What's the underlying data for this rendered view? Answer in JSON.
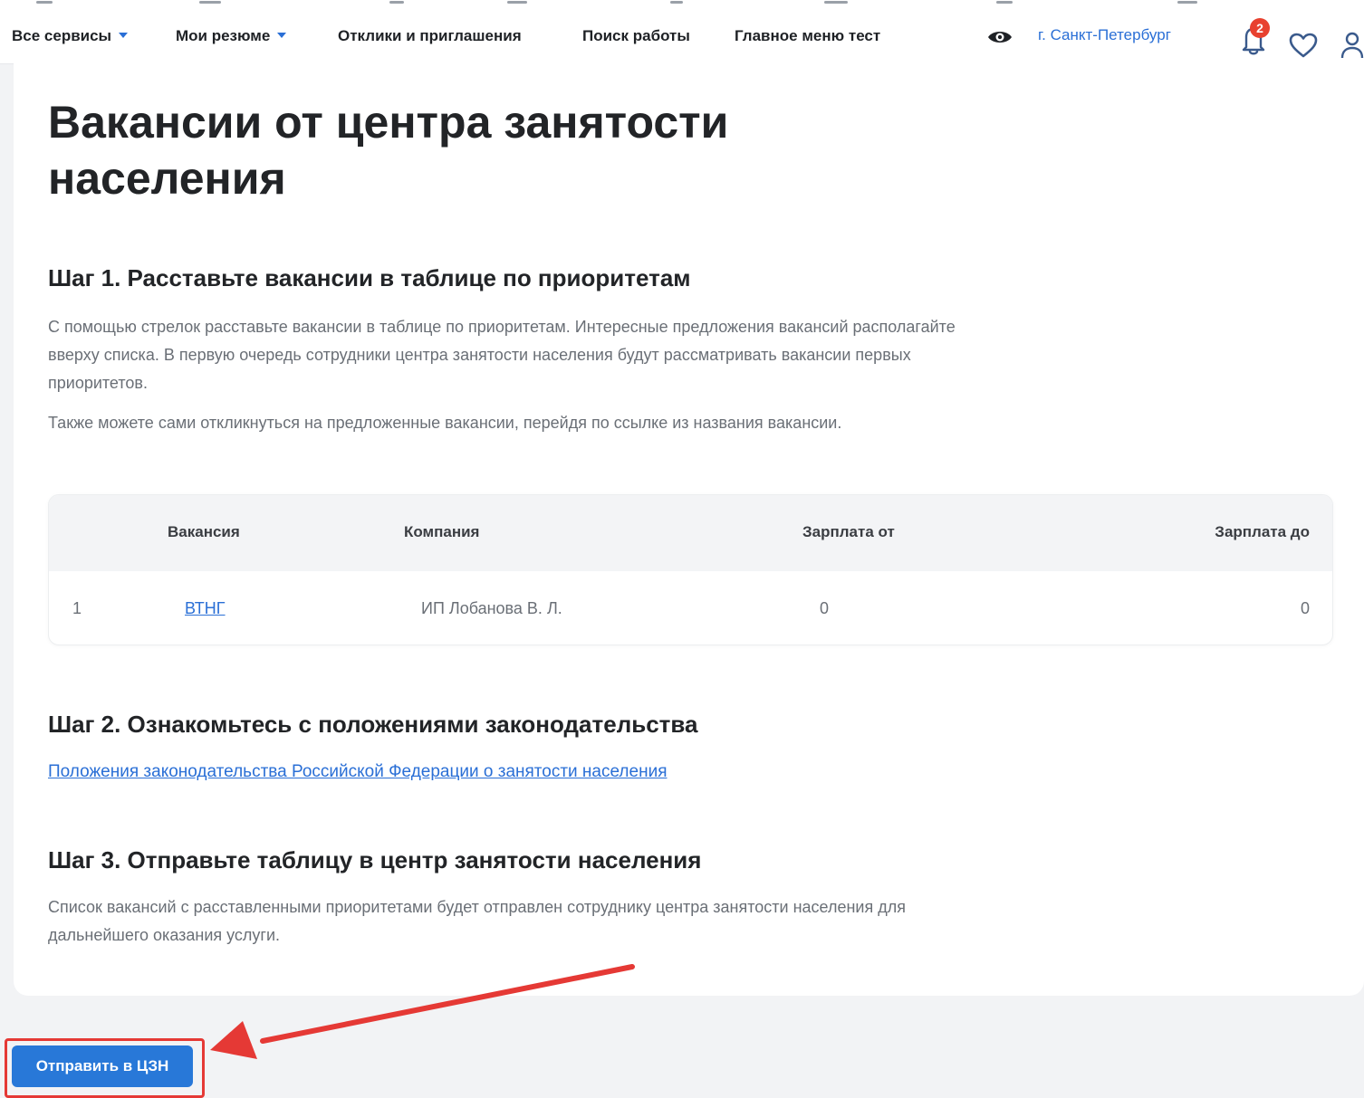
{
  "header": {
    "nav": [
      {
        "label": "Все сервисы",
        "dropdown": true
      },
      {
        "label": "Мои резюме",
        "dropdown": true
      },
      {
        "label": "Отклики и приглашения",
        "dropdown": false
      },
      {
        "label": "Поиск работы",
        "dropdown": false
      },
      {
        "label": "Главное меню тест",
        "dropdown": false
      }
    ],
    "city": "г. Санкт-Петербург",
    "notifications_count": "2",
    "icons": [
      "eye-icon",
      "bell-icon",
      "heart-icon",
      "user-icon"
    ]
  },
  "page": {
    "title": "Вакансии от центра занятости населения"
  },
  "step1": {
    "title": "Шаг 1. Расставьте вакансии в таблице по приоритетам",
    "text1": "С помощью стрелок расставьте вакансии в таблице по приоритетам. Интересные предложения вакансий располагайте вверху списка. В первую очередь сотрудники центра занятости населения будут рассматривать вакансии первых приоритетов.",
    "text2": "Также можете сами откликнуться на предложенные вакансии, перейдя по ссылке из названия вакансии."
  },
  "table": {
    "columns": [
      "Вакансия",
      "Компания",
      "Зарплата от",
      "Зарплата до"
    ],
    "rows": [
      {
        "index": "1",
        "vacancy": "ВТНГ",
        "company": "ИП Лобанова В. Л.",
        "salary_from": "0",
        "salary_to": "0"
      }
    ]
  },
  "step2": {
    "title": "Шаг 2. Ознакомьтесь с положениями законодательства",
    "link": "Положения законодательства Российской Федерации о занятости населения"
  },
  "step3": {
    "title": "Шаг 3. Отправьте таблицу в центр занятости населения",
    "text": "Список вакансий с расставленными приоритетами будет отправлен сотруднику центра занятости населения для дальнейшего оказания услуги."
  },
  "submit": {
    "label": "Отправить в ЦЗН"
  },
  "colors": {
    "accent": "#2a6fd6",
    "button": "#2878d8",
    "badge": "#e8412f",
    "annotation": "#e53935"
  }
}
